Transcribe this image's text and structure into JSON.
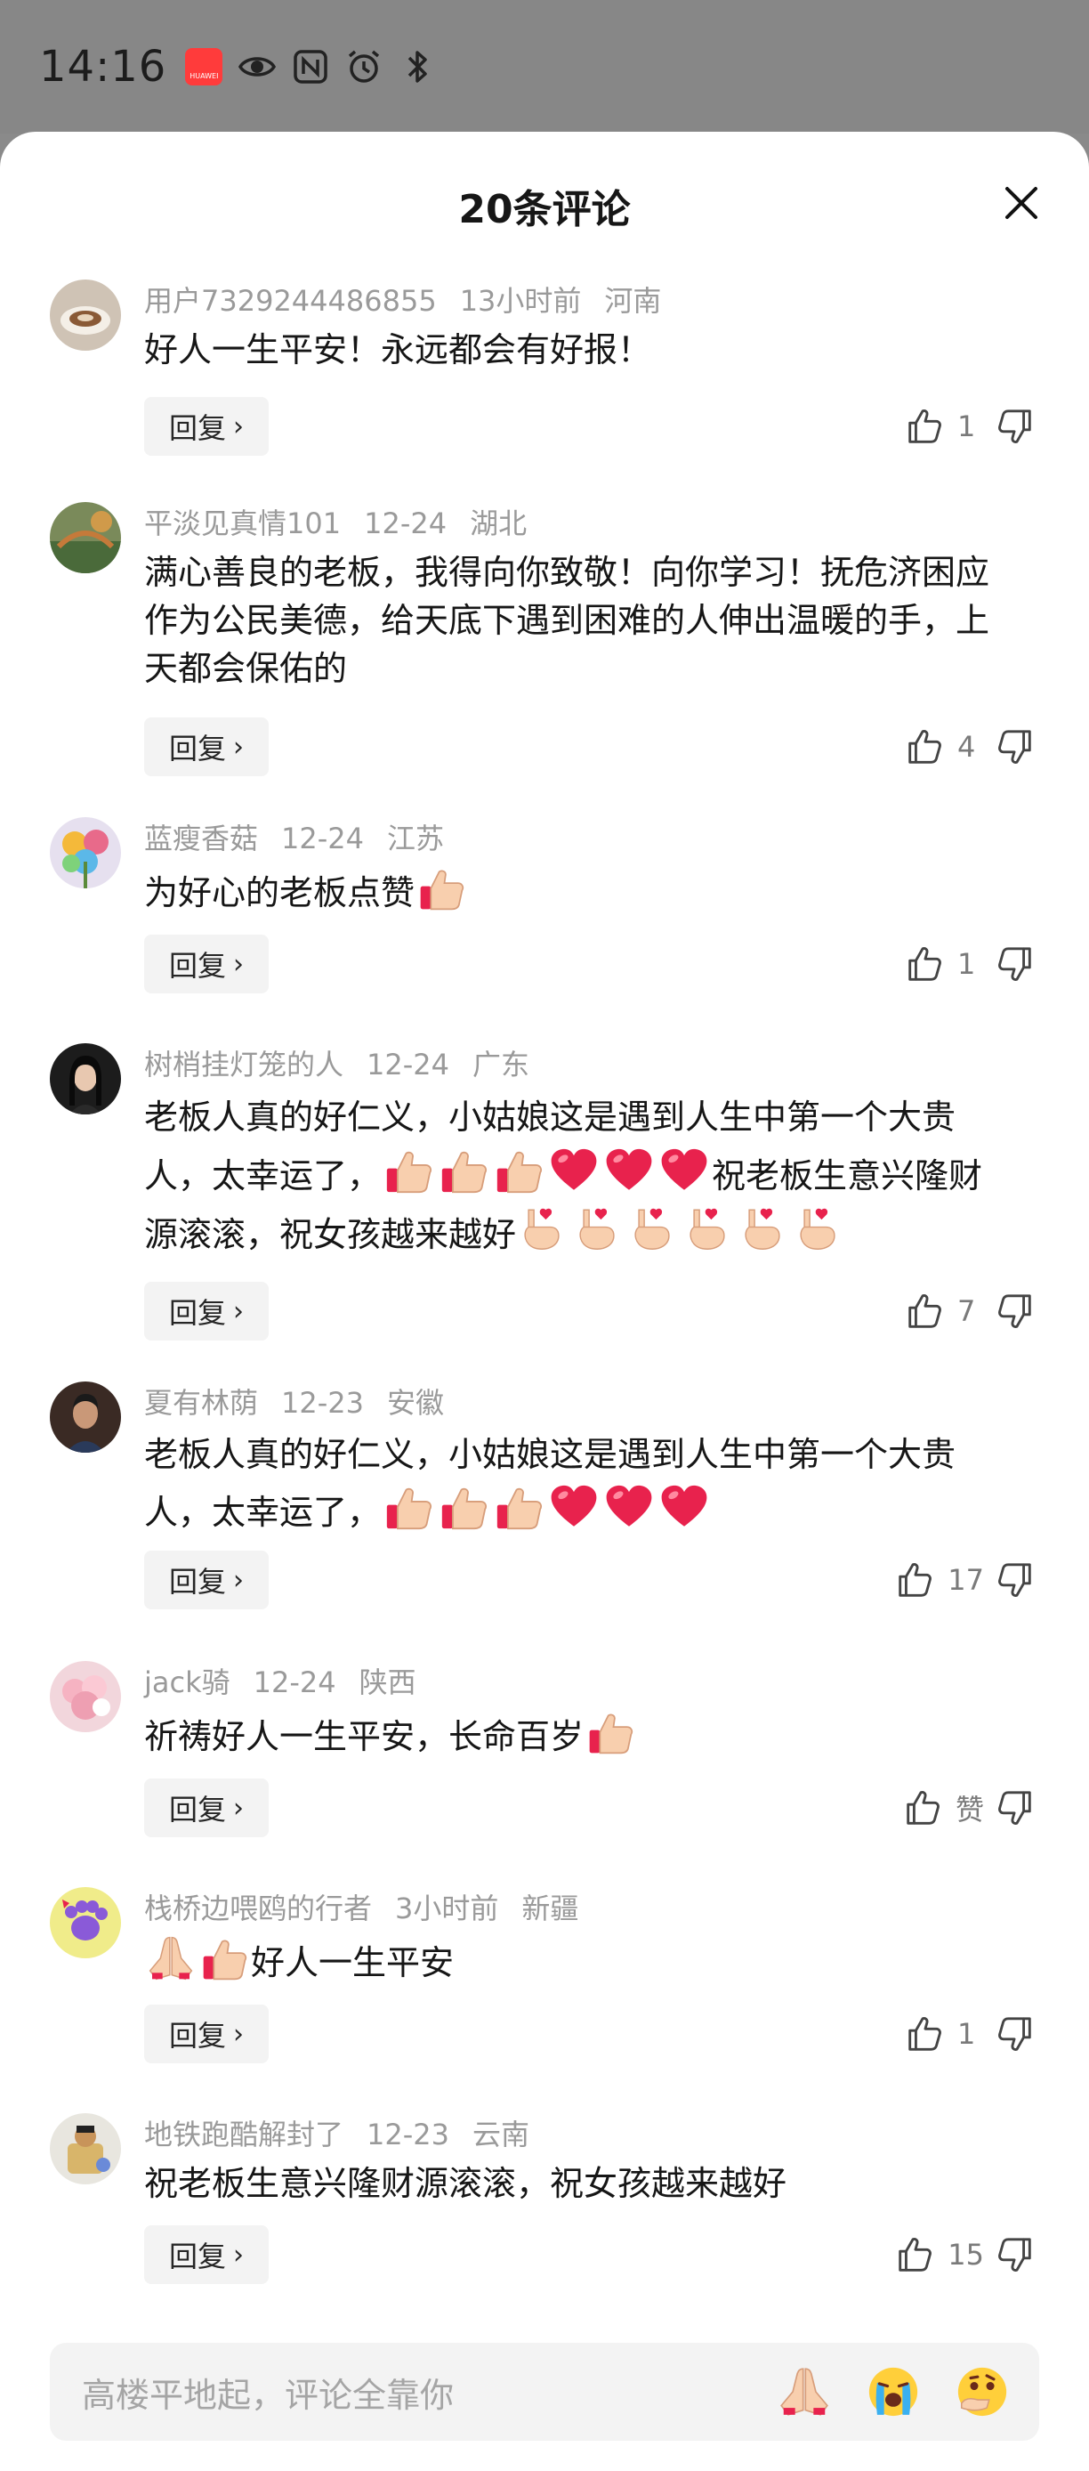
{
  "status_bar": {
    "time": "14:16",
    "badge": "HUAWEI"
  },
  "sheet": {
    "title": "20条评论"
  },
  "reply_label": "回复",
  "comments": [
    {
      "user": "用户7329244486855",
      "time": "13小时前",
      "region": "河南",
      "text_lines": [
        "好人一生平安！永远都会有好报！"
      ],
      "likes": "1"
    },
    {
      "user": "平淡见真情101",
      "time": "12-24",
      "region": "湖北",
      "text_lines": [
        "满心善良的老板，我得向你致敬！向你学习！抚危济困应",
        "作为公民美德，给天底下遇到困难的人伸出温暖的手，上",
        "天都会保佑的"
      ],
      "likes": "4"
    },
    {
      "user": "蓝瘦香菇",
      "time": "12-24",
      "region": "江苏",
      "text_lines": [
        "为好心的老板点赞"
      ],
      "likes": "1"
    },
    {
      "user": "树梢挂灯笼的人",
      "time": "12-24",
      "region": "广东",
      "text_lines": [
        "老板人真的好仁义，小姑娘这是遇到人生中第一个大贵",
        "人，太幸运了，",
        "祝老板生意兴隆财",
        "源滚滚，祝女孩越来越好"
      ],
      "likes": "7"
    },
    {
      "user": "夏有林荫",
      "time": "12-23",
      "region": "安徽",
      "text_lines": [
        "老板人真的好仁义，小姑娘这是遇到人生中第一个大贵",
        "人，太幸运了，"
      ],
      "likes": "17"
    },
    {
      "user": "jack骑",
      "time": "12-24",
      "region": "陕西",
      "text_lines": [
        "祈祷好人一生平安，长命百岁"
      ],
      "likes": "赞"
    },
    {
      "user": "栈桥边喂鸥的行者",
      "time": "3小时前",
      "region": "新疆",
      "text_lines": [
        "好人一生平安"
      ],
      "likes": "1"
    },
    {
      "user": "地铁跑酷解封了",
      "time": "12-23",
      "region": "云南",
      "text_lines": [
        "祝老板生意兴隆财源滚滚，祝女孩越来越好"
      ],
      "likes": "15"
    }
  ],
  "input": {
    "placeholder": "高楼平地起，评论全靠你"
  },
  "colors": {
    "heart": "#e8224d",
    "thumb": "#f5c2a0",
    "muted": "#9a9a9a"
  },
  "icons": [
    "thumbs-up-icon",
    "thumbs-down-icon",
    "close-icon",
    "chevron-right-icon",
    "heart-emoji",
    "thumbs-up-emoji",
    "finger-heart-emoji",
    "pray-emoji",
    "crying-emoji",
    "thinking-emoji"
  ]
}
